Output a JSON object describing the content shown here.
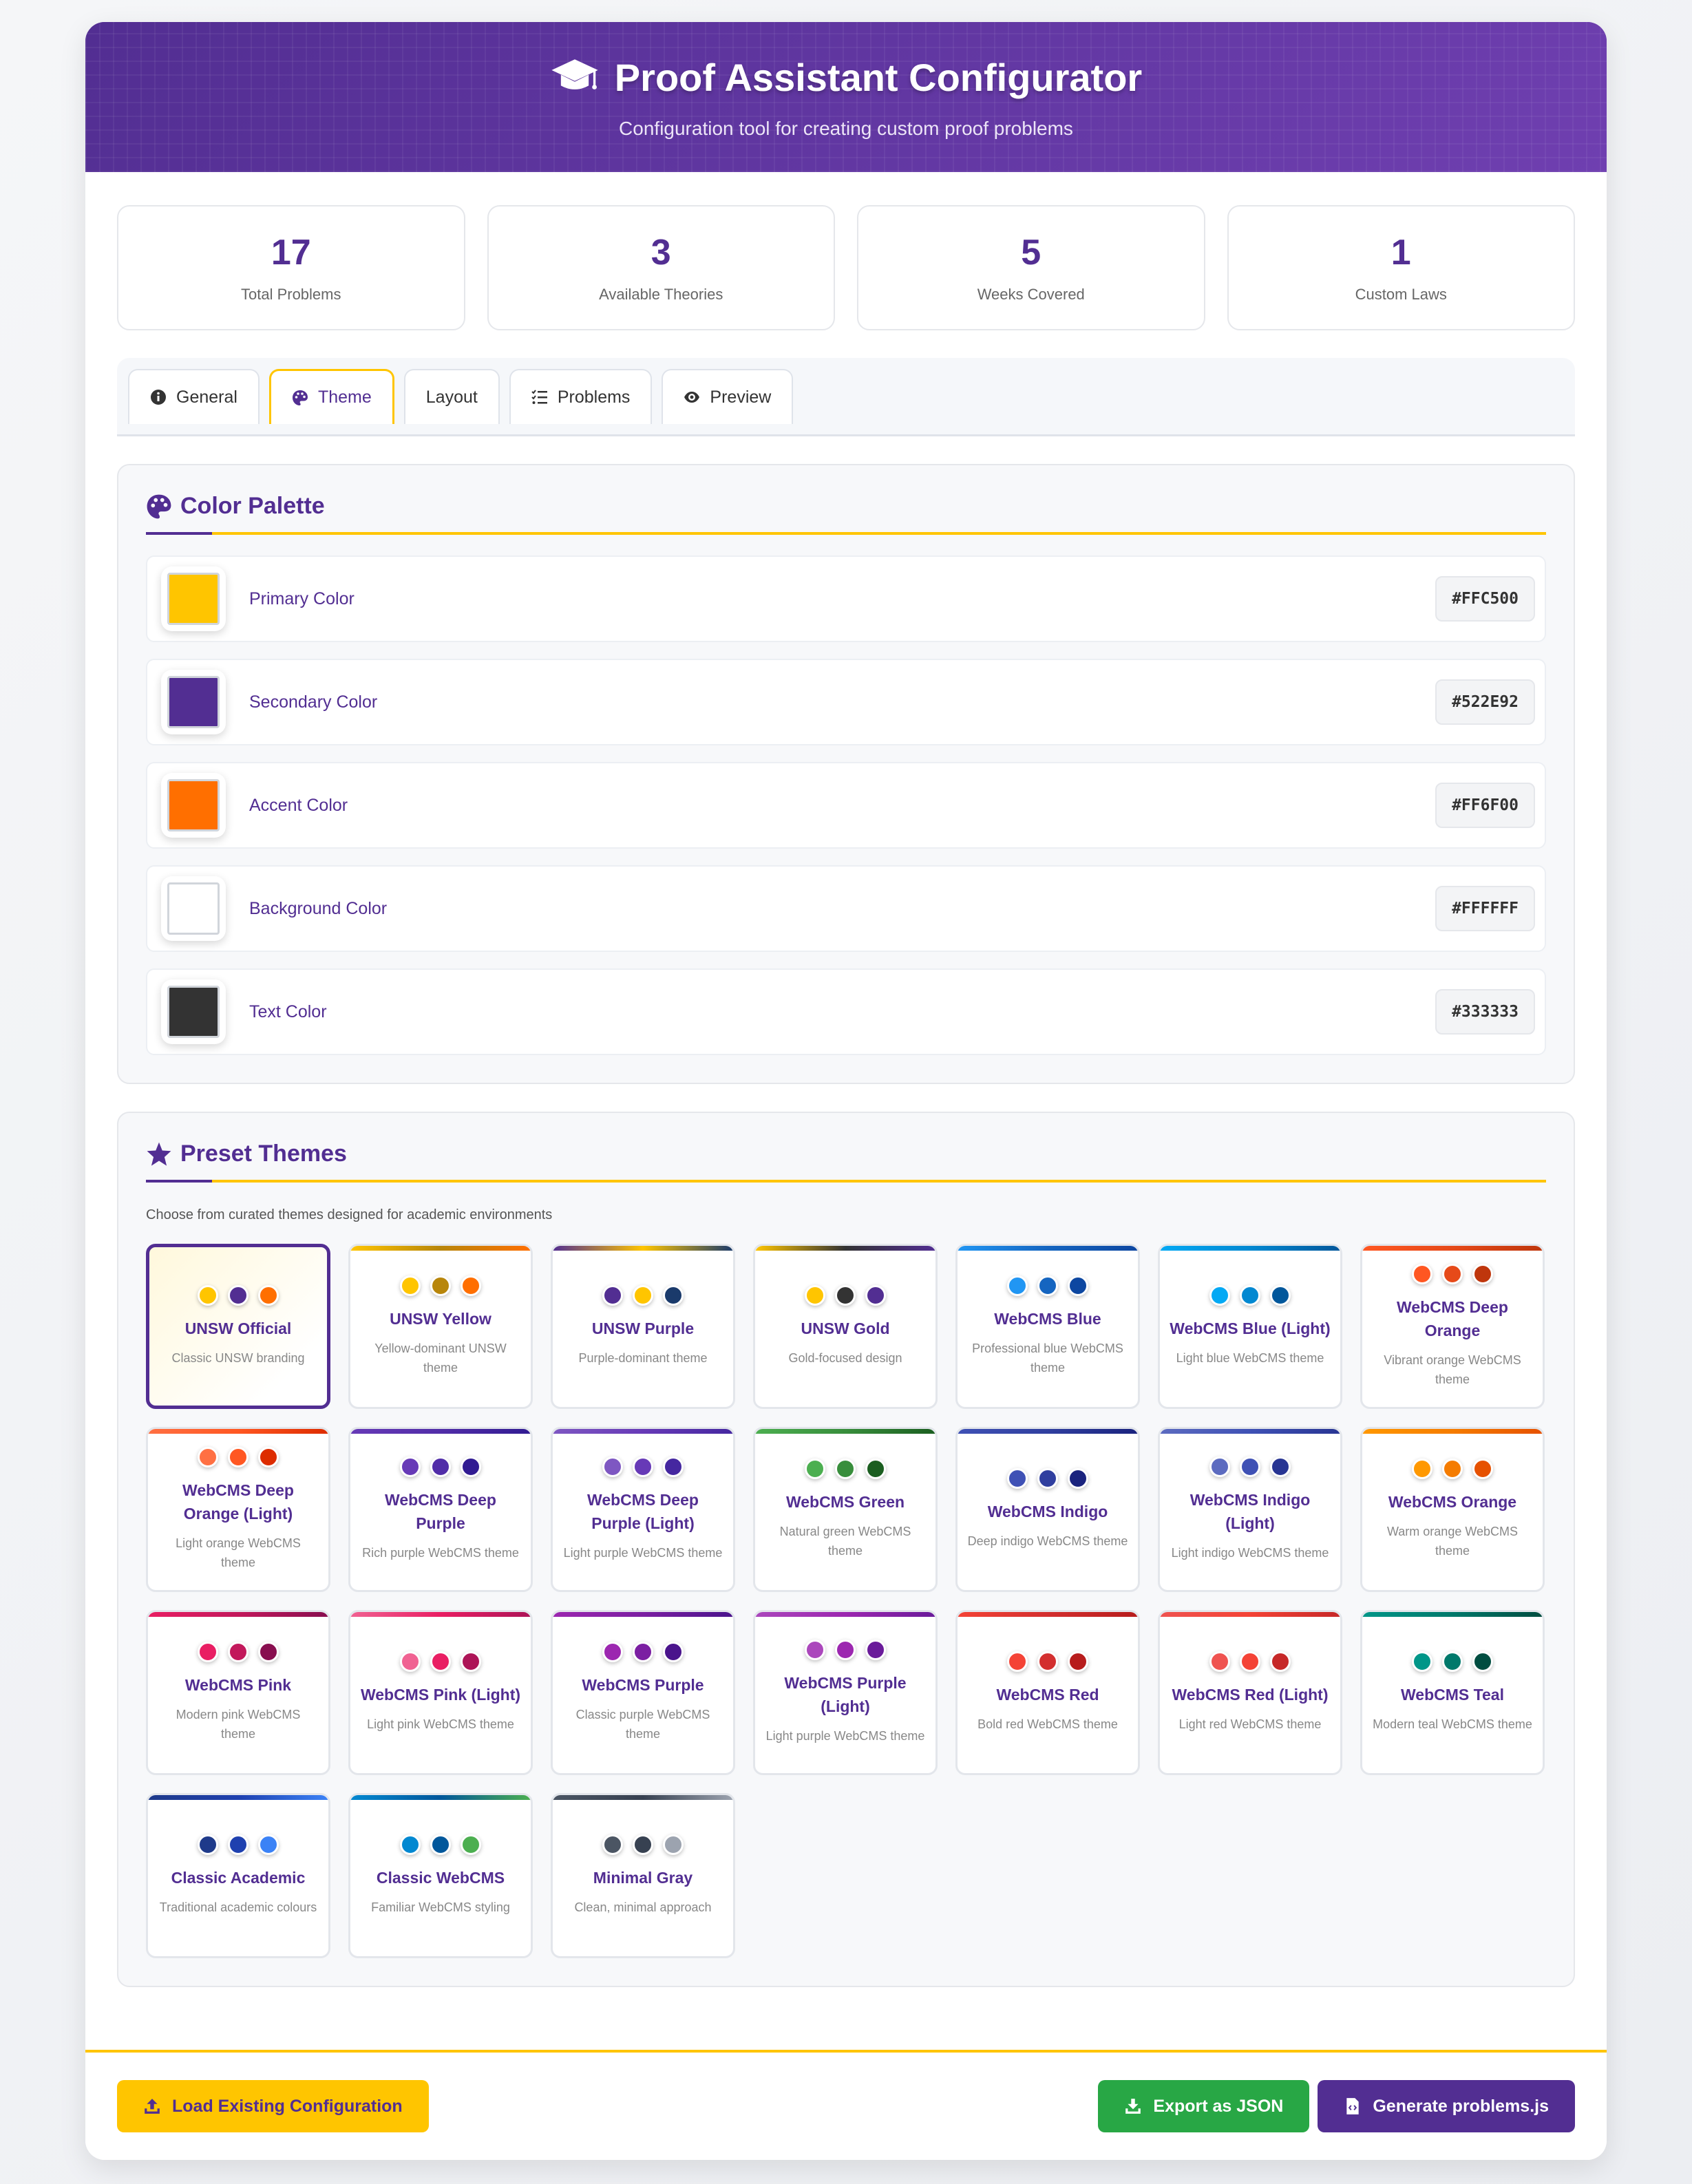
{
  "header": {
    "title": "Proof Assistant Configurator",
    "subtitle": "Configuration tool for creating custom proof problems",
    "icon": "graduation-cap-icon"
  },
  "stats": [
    {
      "value": "17",
      "label": "Total Problems"
    },
    {
      "value": "3",
      "label": "Available Theories"
    },
    {
      "value": "5",
      "label": "Weeks Covered"
    },
    {
      "value": "1",
      "label": "Custom Laws"
    }
  ],
  "tabs": [
    {
      "label": "General",
      "icon": "info-icon"
    },
    {
      "label": "Theme",
      "icon": "palette-icon",
      "active": true
    },
    {
      "label": "Layout",
      "icon": "layout-icon"
    },
    {
      "label": "Problems",
      "icon": "list-check-icon"
    },
    {
      "label": "Preview",
      "icon": "eye-icon"
    }
  ],
  "palette": {
    "title": "Color Palette",
    "colors": [
      {
        "label": "Primary Color",
        "hex": "#FFC500"
      },
      {
        "label": "Secondary Color",
        "hex": "#522E92"
      },
      {
        "label": "Accent Color",
        "hex": "#FF6F00"
      },
      {
        "label": "Background Color",
        "hex": "#FFFFFF"
      },
      {
        "label": "Text Color",
        "hex": "#333333"
      }
    ]
  },
  "presets": {
    "title": "Preset Themes",
    "description": "Choose from curated themes designed for academic environments",
    "themes": [
      {
        "name": "UNSW Official",
        "desc": "Classic UNSW branding",
        "colors": [
          "#FFC500",
          "#522E92",
          "#FF6F00"
        ],
        "active": true
      },
      {
        "name": "UNSW Yellow",
        "desc": "Yellow-dominant UNSW theme",
        "colors": [
          "#FFC500",
          "#B8860B",
          "#FF6F00"
        ]
      },
      {
        "name": "UNSW Purple",
        "desc": "Purple-dominant theme",
        "colors": [
          "#522E92",
          "#FFC500",
          "#1A3A6B"
        ]
      },
      {
        "name": "UNSW Gold",
        "desc": "Gold-focused design",
        "colors": [
          "#FFC500",
          "#333333",
          "#522E92"
        ]
      },
      {
        "name": "WebCMS Blue",
        "desc": "Professional blue WebCMS theme",
        "colors": [
          "#2196F3",
          "#1565C0",
          "#0D47A1"
        ]
      },
      {
        "name": "WebCMS Blue (Light)",
        "desc": "Light blue WebCMS theme",
        "colors": [
          "#03A9F4",
          "#0288D1",
          "#01579B"
        ]
      },
      {
        "name": "WebCMS Deep Orange",
        "desc": "Vibrant orange WebCMS theme",
        "colors": [
          "#FF5722",
          "#E64A19",
          "#BF360C"
        ]
      },
      {
        "name": "WebCMS Deep Orange (Light)",
        "desc": "Light orange WebCMS theme",
        "colors": [
          "#FF7043",
          "#FF5722",
          "#DD2C00"
        ]
      },
      {
        "name": "WebCMS Deep Purple",
        "desc": "Rich purple WebCMS theme",
        "colors": [
          "#673AB7",
          "#512DA8",
          "#311B92"
        ]
      },
      {
        "name": "WebCMS Deep Purple (Light)",
        "desc": "Light purple WebCMS theme",
        "colors": [
          "#7E57C2",
          "#673AB7",
          "#4527A0"
        ]
      },
      {
        "name": "WebCMS Green",
        "desc": "Natural green WebCMS theme",
        "colors": [
          "#4CAF50",
          "#388E3C",
          "#1B5E20"
        ]
      },
      {
        "name": "WebCMS Indigo",
        "desc": "Deep indigo WebCMS theme",
        "colors": [
          "#3F51B5",
          "#303F9F",
          "#1A237E"
        ]
      },
      {
        "name": "WebCMS Indigo (Light)",
        "desc": "Light indigo WebCMS theme",
        "colors": [
          "#5C6BC0",
          "#3F51B5",
          "#283593"
        ]
      },
      {
        "name": "WebCMS Orange",
        "desc": "Warm orange WebCMS theme",
        "colors": [
          "#FF9800",
          "#F57C00",
          "#E65100"
        ]
      },
      {
        "name": "WebCMS Pink",
        "desc": "Modern pink WebCMS theme",
        "colors": [
          "#E91E63",
          "#C2185B",
          "#880E4F"
        ]
      },
      {
        "name": "WebCMS Pink (Light)",
        "desc": "Light pink WebCMS theme",
        "colors": [
          "#F06292",
          "#E91E63",
          "#AD1457"
        ]
      },
      {
        "name": "WebCMS Purple",
        "desc": "Classic purple WebCMS theme",
        "colors": [
          "#9C27B0",
          "#7B1FA2",
          "#4A148C"
        ]
      },
      {
        "name": "WebCMS Purple (Light)",
        "desc": "Light purple WebCMS theme",
        "colors": [
          "#AB47BC",
          "#9C27B0",
          "#6A1B9A"
        ]
      },
      {
        "name": "WebCMS Red",
        "desc": "Bold red WebCMS theme",
        "colors": [
          "#F44336",
          "#D32F2F",
          "#B71C1C"
        ]
      },
      {
        "name": "WebCMS Red (Light)",
        "desc": "Light red WebCMS theme",
        "colors": [
          "#EF5350",
          "#F44336",
          "#C62828"
        ]
      },
      {
        "name": "WebCMS Teal",
        "desc": "Modern teal WebCMS theme",
        "colors": [
          "#009688",
          "#00796B",
          "#004D40"
        ]
      },
      {
        "name": "Classic Academic",
        "desc": "Traditional academic colours",
        "colors": [
          "#1E3A8A",
          "#1E40AF",
          "#3B82F6"
        ]
      },
      {
        "name": "Classic WebCMS",
        "desc": "Familiar WebCMS styling",
        "colors": [
          "#0288D1",
          "#01579B",
          "#4CAF50"
        ]
      },
      {
        "name": "Minimal Gray",
        "desc": "Clean, minimal approach",
        "colors": [
          "#4B5563",
          "#374151",
          "#9CA3AF"
        ]
      }
    ]
  },
  "footer": {
    "load_label": "Load Existing Configuration",
    "export_label": "Export as JSON",
    "generate_label": "Generate problems.js"
  }
}
